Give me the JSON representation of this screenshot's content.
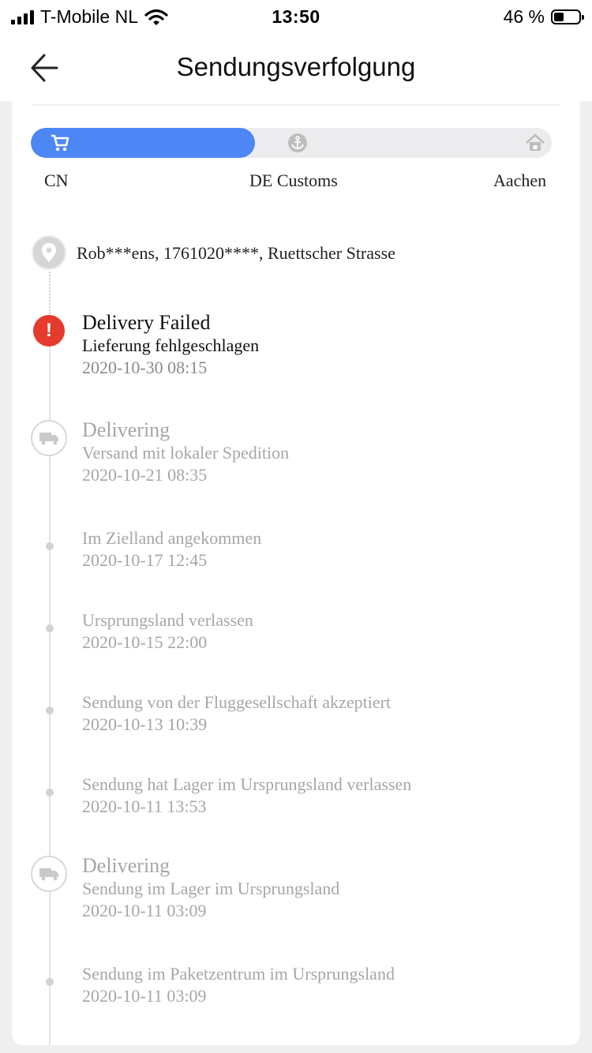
{
  "status_bar": {
    "carrier": "T-Mobile NL",
    "time": "13:50",
    "battery": "46 %",
    "battery_level": 0.46
  },
  "nav": {
    "title": "Sendungsverfolgung",
    "back_icon": "arrow-left-icon"
  },
  "progress": {
    "level": 0.43,
    "stages": [
      {
        "label": "CN",
        "icon": "cart-icon"
      },
      {
        "label": "DE Customs",
        "icon": "anchor-icon"
      },
      {
        "label": "Aachen",
        "icon": "house-icon"
      }
    ],
    "colors": {
      "active": "#4d86f5",
      "track": "#ececee"
    }
  },
  "recipient": {
    "icon": "location-pin-icon",
    "text": "Rob***ens,  1761020****,  Ruettscher Strasse"
  },
  "events": [
    {
      "title": "Delivery Failed",
      "detail": "Lieferung fehlgeschlagen",
      "time": "2020-10-30 08:15",
      "icon": "alert-icon",
      "status_color": "#e53b2c"
    },
    {
      "title": "Delivering",
      "detail": "Versand mit lokaler Spedition",
      "time": "2020-10-21 08:35",
      "icon": "truck-icon"
    },
    {
      "detail": "Im Zielland angekommen",
      "time": "2020-10-17 12:45"
    },
    {
      "detail": "Ursprungsland verlassen",
      "time": "2020-10-15 22:00"
    },
    {
      "detail": "Sendung von der Fluggesellschaft akzeptiert",
      "time": "2020-10-13 10:39"
    },
    {
      "detail": "Sendung hat Lager im Ursprungsland verlassen",
      "time": "2020-10-11 13:53"
    },
    {
      "title": "Delivering",
      "detail": "Sendung im Lager im Ursprungsland",
      "time": "2020-10-11 03:09",
      "icon": "truck-icon"
    },
    {
      "detail": "Sendung im Paketzentrum im Ursprungsland",
      "time": "2020-10-11 03:09"
    }
  ]
}
